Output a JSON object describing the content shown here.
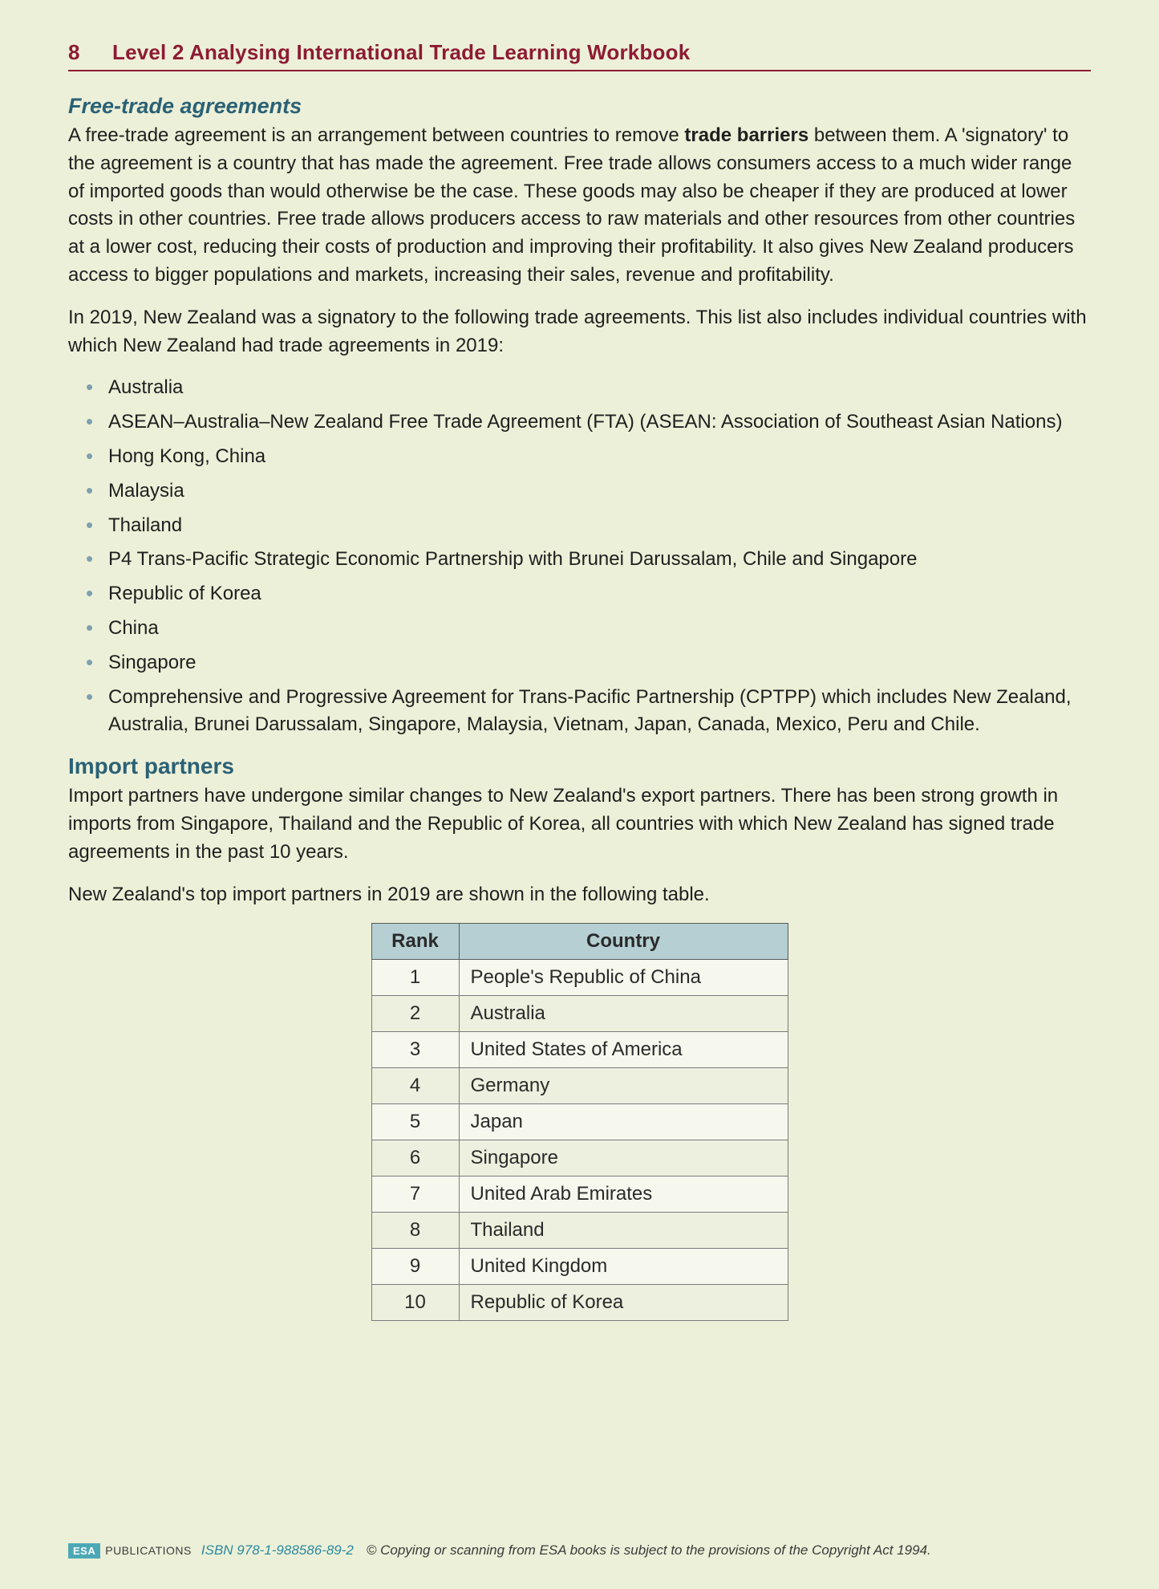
{
  "header": {
    "page_number": "8",
    "title": "Level 2 Analysing International Trade Learning Workbook"
  },
  "section1": {
    "title": "Free-trade agreements",
    "para1_a": "A free-trade agreement is an arrangement between countries to remove ",
    "para1_bold": "trade barriers",
    "para1_b": " between them. A 'signatory' to the agreement is a country that has made the agreement. Free trade allows consumers access to a much wider range of imported goods than would otherwise be the case. These goods may also be cheaper if they are produced at lower costs in other countries. Free trade allows producers access to raw materials and other resources from other countries at a lower cost, reducing their costs of production and improving their profitability. It also gives New Zealand producers access to bigger populations and markets, increasing their sales, revenue and profitability.",
    "para2": "In 2019, New Zealand was a signatory to the following trade agreements. This list also includes individual countries with which New Zealand had trade agreements in 2019:",
    "agreements": [
      "Australia",
      "ASEAN–Australia–New Zealand Free Trade Agreement (FTA) (ASEAN: Association of Southeast Asian Nations)",
      "Hong Kong, China",
      "Malaysia",
      "Thailand",
      "P4 Trans-Pacific Strategic Economic Partnership with Brunei Darussalam, Chile and Singapore",
      "Republic of Korea",
      "China",
      "Singapore",
      "Comprehensive and Progressive Agreement for Trans-Pacific Partnership (CPTPP) which includes New Zealand, Australia, Brunei Darussalam, Singapore, Malaysia, Vietnam, Japan, Canada, Mexico, Peru and Chile."
    ]
  },
  "section2": {
    "title": "Import partners",
    "para1": "Import partners have undergone similar changes to New Zealand's export partners. There has been strong growth in imports from Singapore, Thailand and the Republic of Korea, all countries with which New Zealand has signed trade agreements in the past 10 years.",
    "para2": "New Zealand's top import partners in 2019 are shown in the following table.",
    "table": {
      "headers": {
        "rank": "Rank",
        "country": "Country"
      },
      "rows": [
        {
          "rank": "1",
          "country": "People's Republic of China"
        },
        {
          "rank": "2",
          "country": "Australia"
        },
        {
          "rank": "3",
          "country": "United States of America"
        },
        {
          "rank": "4",
          "country": "Germany"
        },
        {
          "rank": "5",
          "country": "Japan"
        },
        {
          "rank": "6",
          "country": "Singapore"
        },
        {
          "rank": "7",
          "country": "United Arab Emirates"
        },
        {
          "rank": "8",
          "country": "Thailand"
        },
        {
          "rank": "9",
          "country": "United Kingdom"
        },
        {
          "rank": "10",
          "country": "Republic of Korea"
        }
      ]
    }
  },
  "footer": {
    "badge": "ESA",
    "pub": "PUBLICATIONS",
    "isbn": "ISBN 978-1-988586-89-2",
    "copy": "© Copying or scanning from ESA books is subject to the provisions of the Copyright Act 1994."
  }
}
